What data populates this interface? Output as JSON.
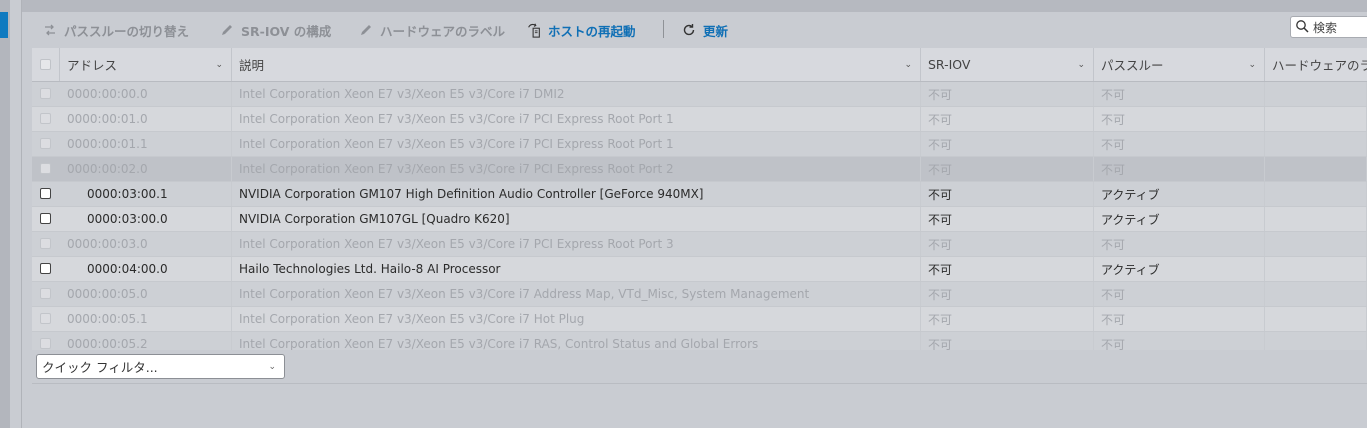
{
  "toolbar": {
    "passthrough_toggle": "パススルーの切り替え",
    "sriov_config": "SR-IOV の構成",
    "hw_label": "ハードウェアのラベル",
    "reboot_host": "ホストの再起動",
    "refresh": "更新",
    "search_placeholder": "検索"
  },
  "table": {
    "columns": [
      "アドレス",
      "説明",
      "SR-IOV",
      "パススルー",
      "ハードウェアのラ"
    ],
    "rows": [
      {
        "address": "0000:00:00.0",
        "description": "Intel Corporation Xeon E7 v3/Xeon E5 v3/Core i7 DMI2",
        "sriov": "不可",
        "passthrough": "不可",
        "hw_label": ""
      },
      {
        "address": "0000:00:01.0",
        "description": "Intel Corporation Xeon E7 v3/Xeon E5 v3/Core i7 PCI Express Root Port 1",
        "sriov": "不可",
        "passthrough": "不可",
        "hw_label": ""
      },
      {
        "address": "0000:00:01.1",
        "description": "Intel Corporation Xeon E7 v3/Xeon E5 v3/Core i7 PCI Express Root Port 1",
        "sriov": "不可",
        "passthrough": "不可",
        "hw_label": ""
      },
      {
        "address": "0000:00:02.0",
        "description": "Intel Corporation Xeon E7 v3/Xeon E5 v3/Core i7 PCI Express Root Port 2",
        "sriov": "不可",
        "passthrough": "不可",
        "hw_label": ""
      },
      {
        "address": "0000:03:00.1",
        "description": "NVIDIA Corporation GM107 High Definition Audio Controller [GeForce 940MX]",
        "sriov": "不可",
        "passthrough": "アクティブ",
        "hw_label": ""
      },
      {
        "address": "0000:03:00.0",
        "description": "NVIDIA Corporation GM107GL [Quadro K620]",
        "sriov": "不可",
        "passthrough": "アクティブ",
        "hw_label": ""
      },
      {
        "address": "0000:00:03.0",
        "description": "Intel Corporation Xeon E7 v3/Xeon E5 v3/Core i7 PCI Express Root Port 3",
        "sriov": "不可",
        "passthrough": "不可",
        "hw_label": ""
      },
      {
        "address": "0000:04:00.0",
        "description": "Hailo Technologies Ltd. Hailo-8 AI Processor",
        "sriov": "不可",
        "passthrough": "アクティブ",
        "hw_label": ""
      },
      {
        "address": "0000:00:05.0",
        "description": "Intel Corporation Xeon E7 v3/Xeon E5 v3/Core i7 Address Map, VTd_Misc, System Management",
        "sriov": "不可",
        "passthrough": "不可",
        "hw_label": ""
      },
      {
        "address": "0000:00:05.1",
        "description": "Intel Corporation Xeon E7 v3/Xeon E5 v3/Core i7 Hot Plug",
        "sriov": "不可",
        "passthrough": "不可",
        "hw_label": ""
      },
      {
        "address": "0000:00:05.2",
        "description": "Intel Corporation Xeon E7 v3/Xeon E5 v3/Core i7 RAS, Control Status and Global Errors",
        "sriov": "不可",
        "passthrough": "不可",
        "hw_label": ""
      }
    ]
  },
  "filter": {
    "placeholder": "クイック フィルタ..."
  },
  "colors": {
    "accent": "#0f6fb5",
    "disabled_text": "#a4a7ad"
  }
}
